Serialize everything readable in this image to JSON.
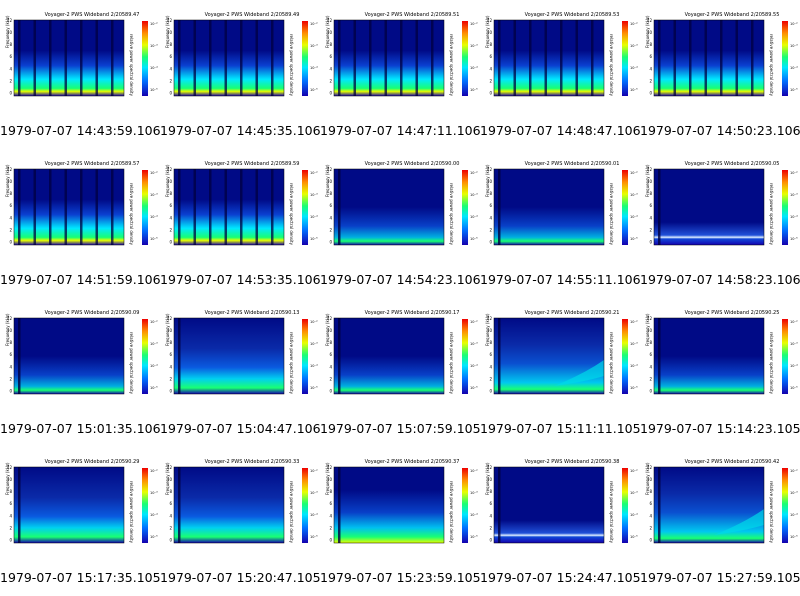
{
  "panel": {
    "ylabel": "Frequency (kHz)",
    "cbar_label": "relative power spectral density",
    "y_ticks": [
      "12",
      "10",
      "8",
      "6",
      "4",
      "2",
      "0"
    ],
    "cbar_ticks": [
      "10⁻²",
      "10⁻³",
      "10⁻⁴",
      "10⁻⁵"
    ],
    "colors": {
      "background": "#000a86",
      "low": "#1400ae",
      "mid": "#00e8ff",
      "high": "#19ff73",
      "peak": "#e8ff00"
    }
  },
  "panels": [
    {
      "title": "Voyager-2  PWS Wideband  2/20589.47",
      "caption": "1979-07-07 14:43:59.106",
      "style": "bursts"
    },
    {
      "title": "Voyager-2  PWS Wideband  2/20589.49",
      "caption": "1979-07-07 14:45:35.106",
      "style": "bursts"
    },
    {
      "title": "Voyager-2  PWS Wideband  2/20589.51",
      "caption": "1979-07-07 14:47:11.106",
      "style": "bursts"
    },
    {
      "title": "Voyager-2  PWS Wideband  2/20589.53",
      "caption": "1979-07-07 14:48:47.106",
      "style": "bursts"
    },
    {
      "title": "Voyager-2  PWS Wideband  2/20589.55",
      "caption": "1979-07-07 14:50:23.106",
      "style": "bursts"
    },
    {
      "title": "Voyager-2  PWS Wideband  2/20589.57",
      "caption": "1979-07-07 14:51:59.106",
      "style": "bursts"
    },
    {
      "title": "Voyager-2  PWS Wideband  2/20589.59",
      "caption": "1979-07-07 14:53:35.106",
      "style": "bursts"
    },
    {
      "title": "Voyager-2  PWS Wideband  2/20590.00",
      "caption": "1979-07-07 14:54:23.106",
      "style": "quiet"
    },
    {
      "title": "Voyager-2  PWS Wideband  2/20590.01",
      "caption": "1979-07-07 14:55:11.106",
      "style": "quiet"
    },
    {
      "title": "Voyager-2  PWS Wideband  2/20590.05",
      "caption": "1979-07-07 14:58:23.106",
      "style": "band"
    },
    {
      "title": "Voyager-2  PWS Wideband  2/20590.09",
      "caption": "1979-07-07 15:01:35.106",
      "style": "quiet"
    },
    {
      "title": "Voyager-2  PWS Wideband  2/20590.13",
      "caption": "1979-07-07 15:04:47.106",
      "style": "broad"
    },
    {
      "title": "Voyager-2  PWS Wideband  2/20590.17",
      "caption": "1979-07-07 15:07:59.105",
      "style": "quiet"
    },
    {
      "title": "Voyager-2  PWS Wideband  2/20590.21",
      "caption": "1979-07-07 15:11:11.105",
      "style": "rising"
    },
    {
      "title": "Voyager-2  PWS Wideband  2/20590.25",
      "caption": "1979-07-07 15:14:23.105",
      "style": "quiet"
    },
    {
      "title": "Voyager-2  PWS Wideband  2/20590.29",
      "caption": "1979-07-07 15:17:35.105",
      "style": "broad"
    },
    {
      "title": "Voyager-2  PWS Wideband  2/20590.33",
      "caption": "1979-07-07 15:20:47.105",
      "style": "broad"
    },
    {
      "title": "Voyager-2  PWS Wideband  2/20590.37",
      "caption": "1979-07-07 15:23:59.105",
      "style": "noisy"
    },
    {
      "title": "Voyager-2  PWS Wideband  2/20590.38",
      "caption": "1979-07-07 15:24:47.105",
      "style": "band"
    },
    {
      "title": "Voyager-2  PWS Wideband  2/20590.42",
      "caption": "1979-07-07 15:27:59.105",
      "style": "rising"
    }
  ]
}
